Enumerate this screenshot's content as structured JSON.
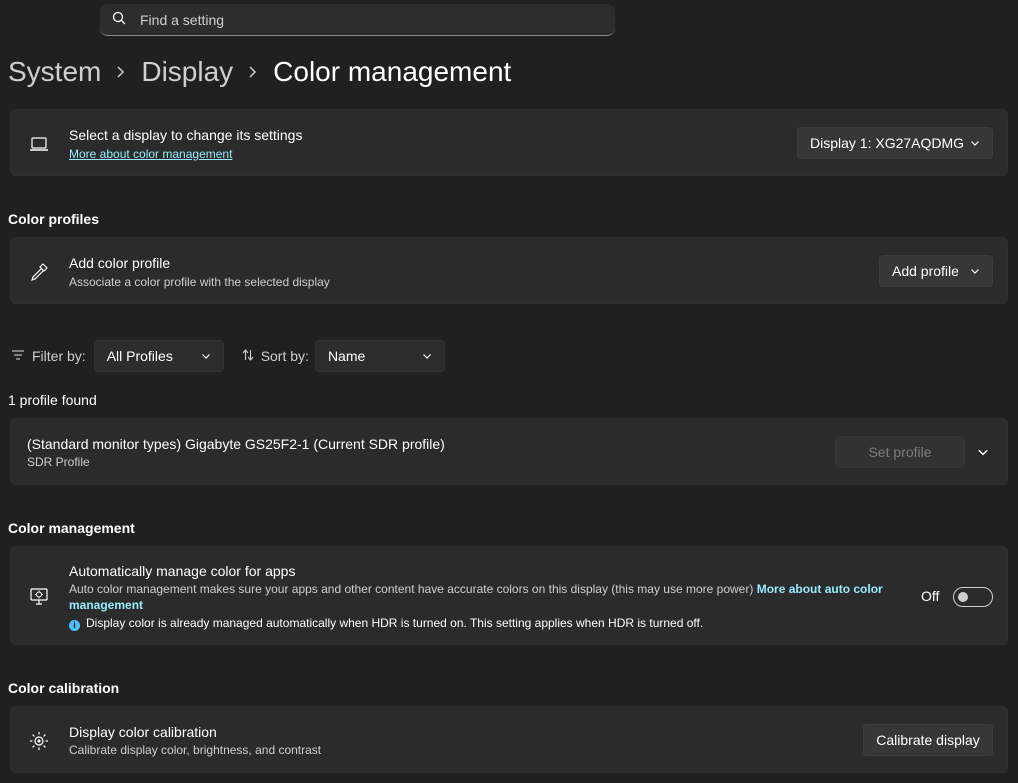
{
  "search": {
    "placeholder": "Find a setting",
    "icon": "search-icon"
  },
  "breadcrumb": {
    "items": [
      "System",
      "Display",
      "Color management"
    ]
  },
  "display_card": {
    "title": "Select a display to change its settings",
    "link": "More about color management",
    "dropdown_value": "Display 1: XG27AQDMG",
    "icon": "laptop-icon"
  },
  "color_profiles": {
    "section_title": "Color profiles",
    "add_title": "Add color profile",
    "add_sub": "Associate a color profile with the selected display",
    "add_button": "Add profile",
    "icon": "eyedropper-icon"
  },
  "filter": {
    "filter_label": "Filter by:",
    "filter_value": "All Profiles",
    "sort_label": "Sort by:",
    "sort_value": "Name"
  },
  "profiles": {
    "count_text": "1 profile found",
    "items": [
      {
        "name": "(Standard monitor types) Gigabyte GS25F2-1 (Current SDR profile)",
        "type": "SDR Profile",
        "button": "Set profile"
      }
    ]
  },
  "color_management": {
    "section_title": "Color management",
    "title": "Automatically manage color for apps",
    "desc": "Auto color management makes sure your apps and other content have accurate colors on this display (this may use more power)",
    "link": "More about auto color management",
    "info": "Display color is already managed automatically when HDR is turned on. This setting applies when HDR is turned off.",
    "toggle_label": "Off",
    "toggle_on": false,
    "icon": "monitor-color-icon"
  },
  "calibration": {
    "section_title": "Color calibration",
    "title": "Display color calibration",
    "sub": "Calibrate display color, brightness, and contrast",
    "button": "Calibrate display",
    "icon": "brightness-icon"
  },
  "colors": {
    "background": "#202020",
    "card": "#2b2b2b",
    "link": "#99ebff",
    "accent": "#4cc2ff"
  }
}
